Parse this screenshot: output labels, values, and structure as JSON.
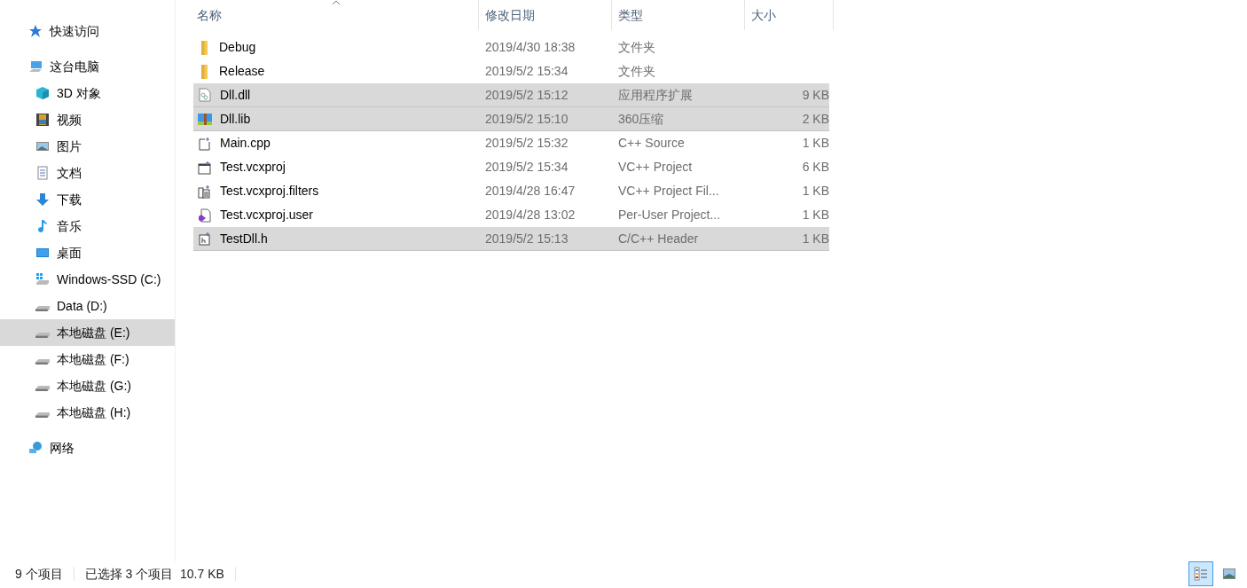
{
  "sidebar": {
    "groups": [
      {
        "label": "快速访问",
        "kind": "quick",
        "selected": false
      },
      {
        "label": "这台电脑",
        "kind": "pc",
        "selected": false,
        "children": [
          {
            "label": "3D 对象",
            "kind": "cube",
            "selected": false
          },
          {
            "label": "视频",
            "kind": "video",
            "selected": false
          },
          {
            "label": "图片",
            "kind": "picture",
            "selected": false
          },
          {
            "label": "文档",
            "kind": "doc",
            "selected": false
          },
          {
            "label": "下载",
            "kind": "download",
            "selected": false
          },
          {
            "label": "音乐",
            "kind": "music",
            "selected": false
          },
          {
            "label": "桌面",
            "kind": "desktop",
            "selected": false
          },
          {
            "label": "Windows-SSD (C:)",
            "kind": "windrive",
            "selected": false
          },
          {
            "label": "Data (D:)",
            "kind": "drive",
            "selected": false
          },
          {
            "label": "本地磁盘 (E:)",
            "kind": "drive",
            "selected": true
          },
          {
            "label": "本地磁盘 (F:)",
            "kind": "drive",
            "selected": false
          },
          {
            "label": "本地磁盘 (G:)",
            "kind": "drive",
            "selected": false
          },
          {
            "label": "本地磁盘 (H:)",
            "kind": "drive",
            "selected": false
          }
        ]
      },
      {
        "label": "网络",
        "kind": "network",
        "selected": false
      }
    ]
  },
  "table": {
    "columns": [
      {
        "label": "名称",
        "sorted": true
      },
      {
        "label": "修改日期",
        "sorted": false
      },
      {
        "label": "类型",
        "sorted": false
      },
      {
        "label": "大小",
        "sorted": false
      }
    ],
    "rows": [
      {
        "name": "Debug",
        "date": "2019/4/30 18:38",
        "type": "文件夹",
        "size": "",
        "kind": "folder",
        "selected": false
      },
      {
        "name": "Release",
        "date": "2019/5/2 15:34",
        "type": "文件夹",
        "size": "",
        "kind": "folder",
        "selected": false
      },
      {
        "name": "Dll.dll",
        "date": "2019/5/2 15:12",
        "type": "应用程序扩展",
        "size": "9 KB",
        "kind": "dll",
        "selected": true
      },
      {
        "name": "Dll.lib",
        "date": "2019/5/2 15:10",
        "type": "360压缩",
        "size": "2 KB",
        "kind": "archive",
        "selected": true
      },
      {
        "name": "Main.cpp",
        "date": "2019/5/2 15:32",
        "type": "C++ Source",
        "size": "1 KB",
        "kind": "cpp",
        "selected": false
      },
      {
        "name": "Test.vcxproj",
        "date": "2019/5/2 15:34",
        "type": "VC++ Project",
        "size": "6 KB",
        "kind": "project",
        "selected": false
      },
      {
        "name": "Test.vcxproj.filters",
        "date": "2019/4/28 16:47",
        "type": "VC++ Project Fil...",
        "size": "1 KB",
        "kind": "filters",
        "selected": false
      },
      {
        "name": "Test.vcxproj.user",
        "date": "2019/4/28 13:02",
        "type": "Per-User Project...",
        "size": "1 KB",
        "kind": "user",
        "selected": false
      },
      {
        "name": "TestDll.h",
        "date": "2019/5/2 15:13",
        "type": "C/C++ Header",
        "size": "1 KB",
        "kind": "header",
        "selected": true
      }
    ]
  },
  "status_bar": {
    "count": "9 个项目",
    "selection": "已选择 3 个项目  10.7 KB",
    "views": [
      {
        "kind": "details",
        "selected": true
      },
      {
        "kind": "large",
        "selected": false
      }
    ]
  }
}
